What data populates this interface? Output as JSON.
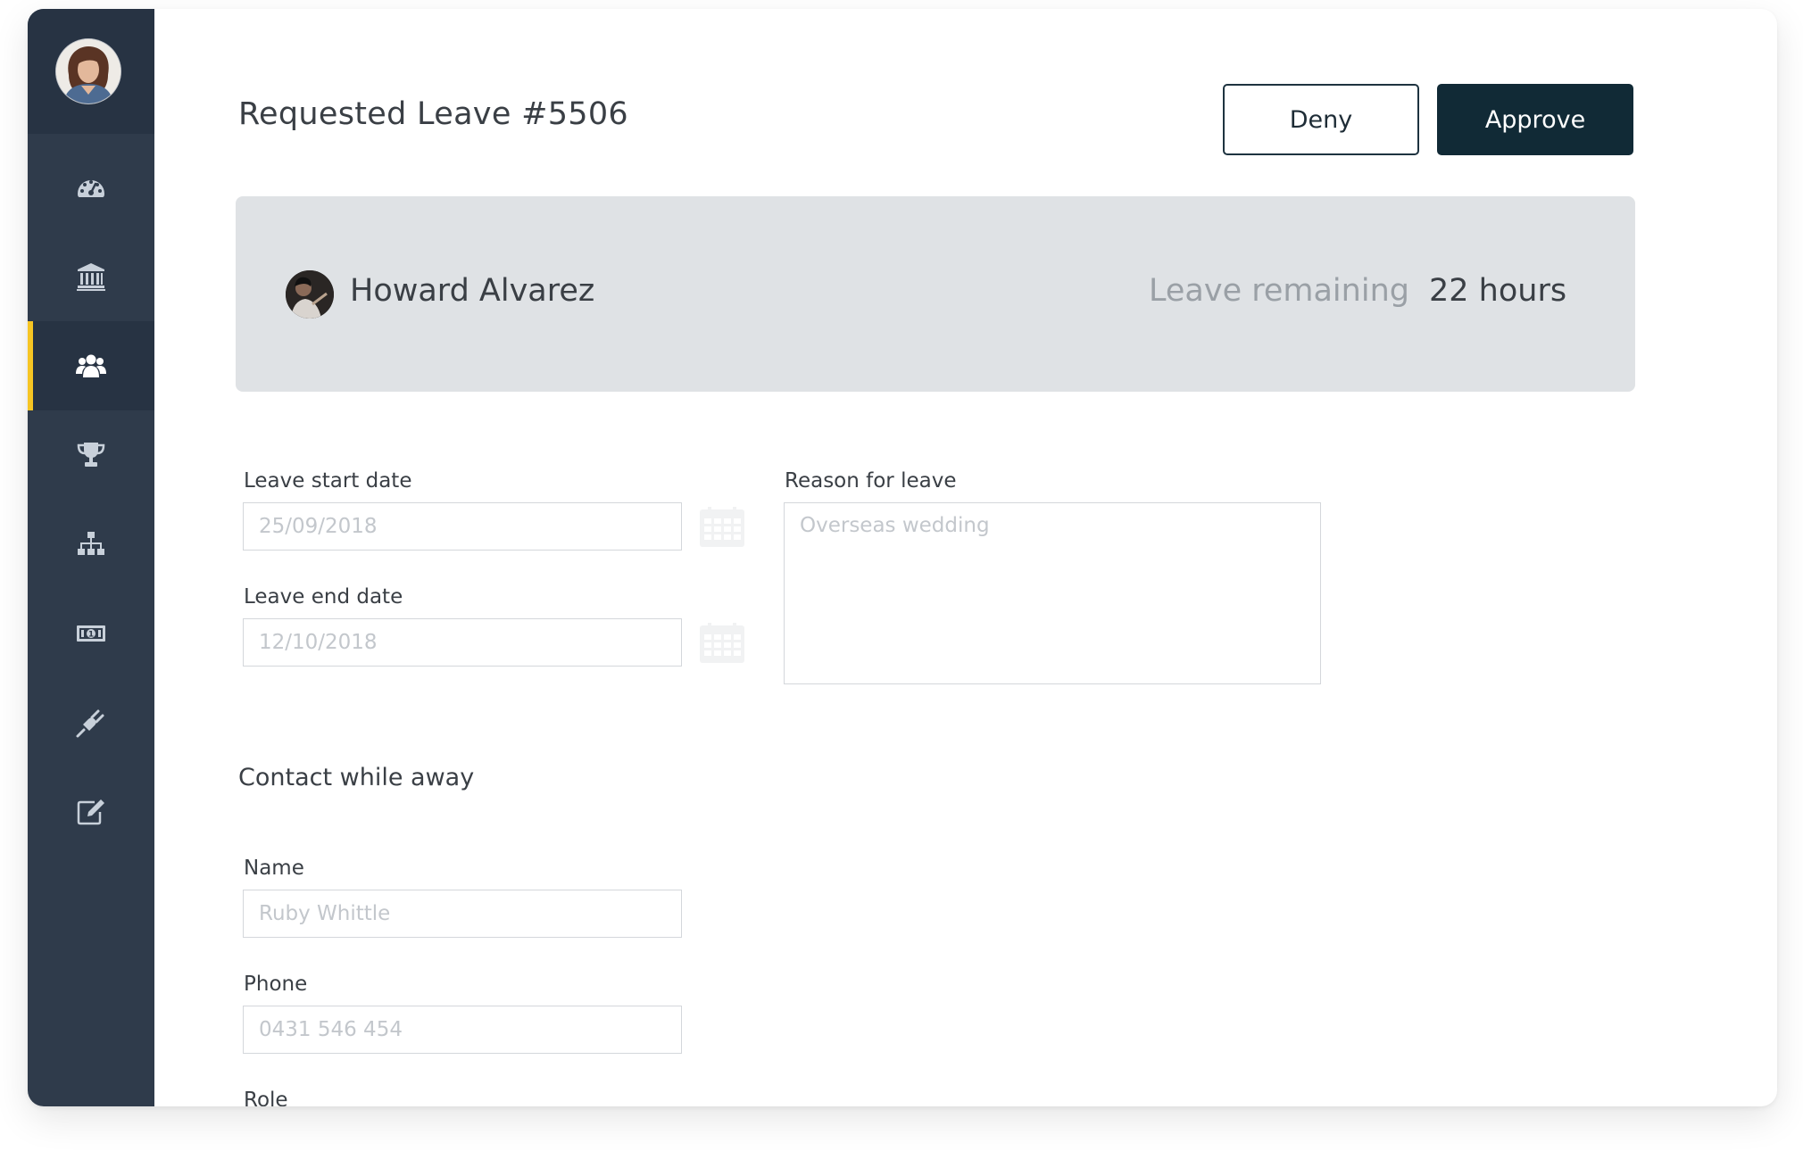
{
  "header": {
    "title": "Requested Leave #5506",
    "deny_label": "Deny",
    "approve_label": "Approve"
  },
  "sidebar": {
    "items": [
      {
        "icon": "dashboard-icon"
      },
      {
        "icon": "bank-icon"
      },
      {
        "icon": "users-icon",
        "active": true
      },
      {
        "icon": "trophy-icon"
      },
      {
        "icon": "org-chart-icon"
      },
      {
        "icon": "money-icon"
      },
      {
        "icon": "plug-icon"
      },
      {
        "icon": "edit-icon"
      }
    ],
    "active_accent": "#f6c523"
  },
  "employee": {
    "name": "Howard Alvarez",
    "leave_remaining_label": "Leave remaining",
    "leave_remaining_value": "22 hours"
  },
  "form": {
    "start_date_label": "Leave start date",
    "start_date_value": "25/09/2018",
    "end_date_label": "Leave end date",
    "end_date_value": "12/10/2018",
    "reason_label": "Reason for leave",
    "reason_value": "Overseas wedding"
  },
  "contact": {
    "section_title": "Contact while away",
    "name_label": "Name",
    "name_value": "Ruby Whittle",
    "phone_label": "Phone",
    "phone_value": "0431 546 454",
    "role_label": "Role"
  },
  "colors": {
    "sidebar": "#2f3b4b",
    "sidebar_dark": "#273343",
    "approve": "#112a36",
    "card": "#dfe2e5"
  }
}
